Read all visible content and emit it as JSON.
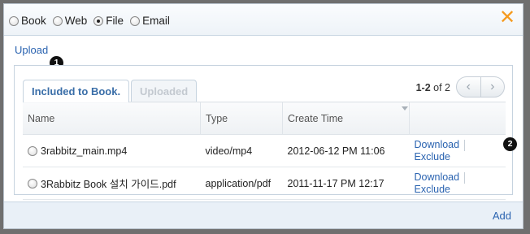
{
  "source_type": {
    "options": [
      {
        "label": "Book",
        "checked": false
      },
      {
        "label": "Web",
        "checked": false
      },
      {
        "label": "File",
        "checked": true
      },
      {
        "label": "Email",
        "checked": false
      }
    ]
  },
  "close_icon": "close-icon",
  "upload_label": "Upload",
  "badges": [
    "1",
    "2"
  ],
  "tabs": [
    {
      "label": "Included to Book.",
      "active": true
    },
    {
      "label": "Uploaded",
      "active": false
    }
  ],
  "pager": {
    "range_bold": "1-2",
    "of_text": " of 2",
    "prev_icon": "chevron-left-icon",
    "next_icon": "chevron-right-icon"
  },
  "table": {
    "headers": [
      "Name",
      "Type",
      "Create Time",
      ""
    ],
    "rows": [
      {
        "name": "3rabbitz_main.mp4",
        "type": "video/mp4",
        "created": "2012-06-12 PM 11:06",
        "download": "Download",
        "exclude": "Exclude"
      },
      {
        "name": "3Rabbitz Book 설치 가이드.pdf",
        "type": "application/pdf",
        "created": "2011-11-17 PM 12:17",
        "download": "Download",
        "exclude": "Exclude"
      }
    ]
  },
  "add_label": "Add",
  "colors": {
    "accent": "#2a63b0",
    "close": "#f59a1e"
  }
}
